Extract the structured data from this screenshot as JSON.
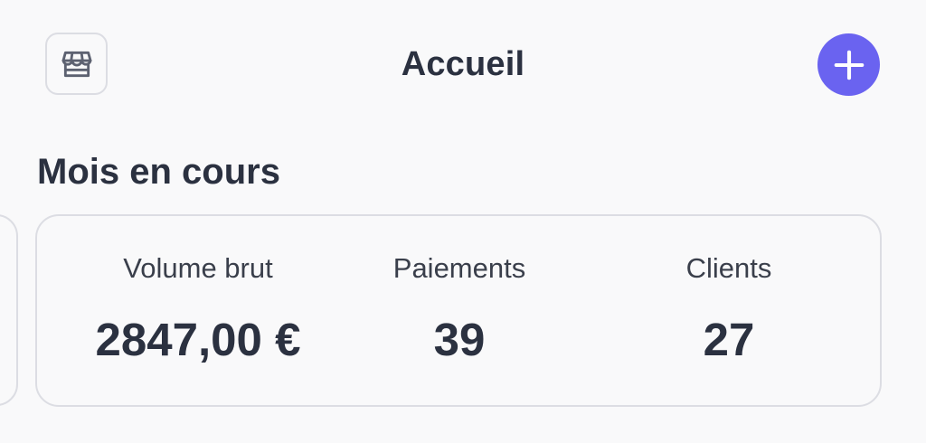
{
  "header": {
    "title": "Accueil",
    "shop_icon": "storefront-icon",
    "add_icon": "plus-icon"
  },
  "current_month": {
    "title": "Mois en cours",
    "stats": {
      "volume": {
        "label": "Volume brut",
        "value": "2847,00 €"
      },
      "payments": {
        "label": "Paiements",
        "value": "39"
      },
      "clients": {
        "label": "Clients",
        "value": "27"
      }
    }
  },
  "colors": {
    "accent": "#6a63f0",
    "text": "#2b3140",
    "border": "#dcdde3",
    "background": "#f9f9fa"
  }
}
